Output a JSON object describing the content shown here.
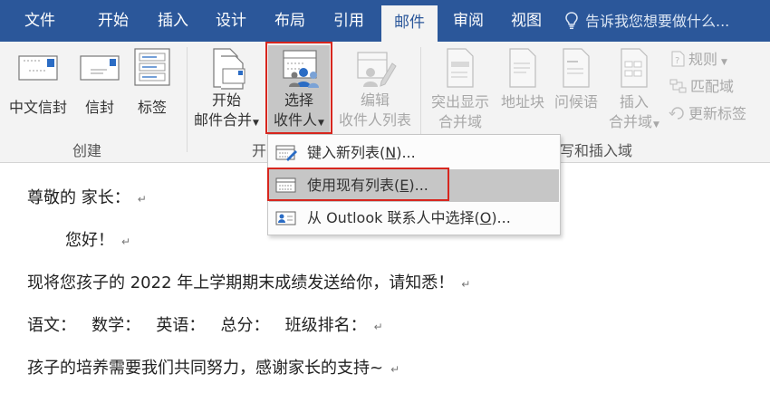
{
  "tabs": [
    {
      "label": "文件",
      "active": false
    },
    {
      "label": "开始",
      "active": false
    },
    {
      "label": "插入",
      "active": false
    },
    {
      "label": "设计",
      "active": false
    },
    {
      "label": "布局",
      "active": false
    },
    {
      "label": "引用",
      "active": false
    },
    {
      "label": "邮件",
      "active": true
    },
    {
      "label": "审阅",
      "active": false
    },
    {
      "label": "视图",
      "active": false
    }
  ],
  "tell_me": "告诉我您想要做什么...",
  "ribbon": {
    "create_group": {
      "label": "创建",
      "chinese_envelope": "中文信封",
      "envelope": "信封",
      "labels": "标签"
    },
    "start_merge": {
      "start_line1": "开始",
      "start_line2": "邮件合并",
      "select_line1": "选择",
      "select_line2": "收件人",
      "edit_line1": "编辑",
      "edit_line2": "收件人列表",
      "group_label_partial": "开"
    },
    "write_insert": {
      "highlight_line1": "突出显示",
      "highlight_line2": "合并域",
      "address_block": "地址块",
      "greeting": "问候语",
      "insert_line1": "插入",
      "insert_line2": "合并域",
      "rules": "规则",
      "match_fields": "匹配域",
      "update_labels": "更新标签",
      "group_label_partial": "写和插入域"
    }
  },
  "dropdown": {
    "items": [
      {
        "label_main": "键入新列表(",
        "hotkey": "N",
        "label_tail": ")...",
        "selected": false
      },
      {
        "label_main": "使用现有列表(",
        "hotkey": "E",
        "label_tail": ")...",
        "selected": true
      },
      {
        "label_main": "从 Outlook 联系人中选择(",
        "hotkey": "O",
        "label_tail": ")...",
        "selected": false
      }
    ]
  },
  "document": {
    "lines": [
      "尊敬的 家长：",
      "您好！",
      "现将您孩子的 2022 年上学期期末成绩发送给你，请知悉！",
      "语文：   数学：   英语：   总分：   班级排名：",
      "孩子的培养需要我们共同努力，感谢家长的支持~"
    ],
    "paragraph_mark": "↵"
  },
  "colors": {
    "tab_bar": "#2b579a",
    "ribbon": "#f3f3f3",
    "highlight_box": "#d7261e",
    "selected_item": "#c6c6c6"
  }
}
